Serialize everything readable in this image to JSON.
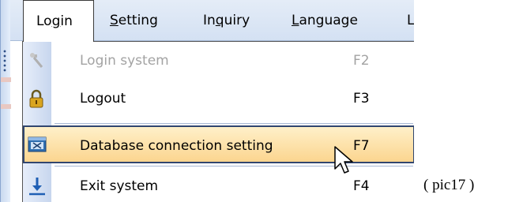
{
  "menubar": {
    "items": [
      {
        "label": "Login",
        "mnemonic": "g",
        "active": true
      },
      {
        "label": "Setting",
        "mnemonic": "S",
        "active": false
      },
      {
        "label": "Inquiry",
        "mnemonic": "q",
        "active": false
      },
      {
        "label": "Language",
        "mnemonic": "L",
        "active": false
      },
      {
        "label": "L",
        "active": false
      }
    ]
  },
  "dropdown": {
    "items": [
      {
        "label": "Login system",
        "shortcut": "F2",
        "enabled": false,
        "icon": "login-system-icon"
      },
      {
        "label": "Logout",
        "shortcut": "F3",
        "enabled": true,
        "icon": "padlock-icon"
      },
      {
        "label": "Database connection setting",
        "shortcut": "F7",
        "enabled": true,
        "highlighted": true,
        "icon": "database-settings-icon"
      },
      {
        "label": "Exit system",
        "shortcut": "F4",
        "enabled": true,
        "icon": "exit-arrow-icon"
      }
    ]
  },
  "caption": "( pic17 )",
  "colors": {
    "highlight_top": "#fff0c9",
    "highlight_bottom": "#fbd58f",
    "highlight_border": "#31466f",
    "menubar_bg": "#d4e1f3",
    "disabled_text": "#a3a3a3"
  }
}
